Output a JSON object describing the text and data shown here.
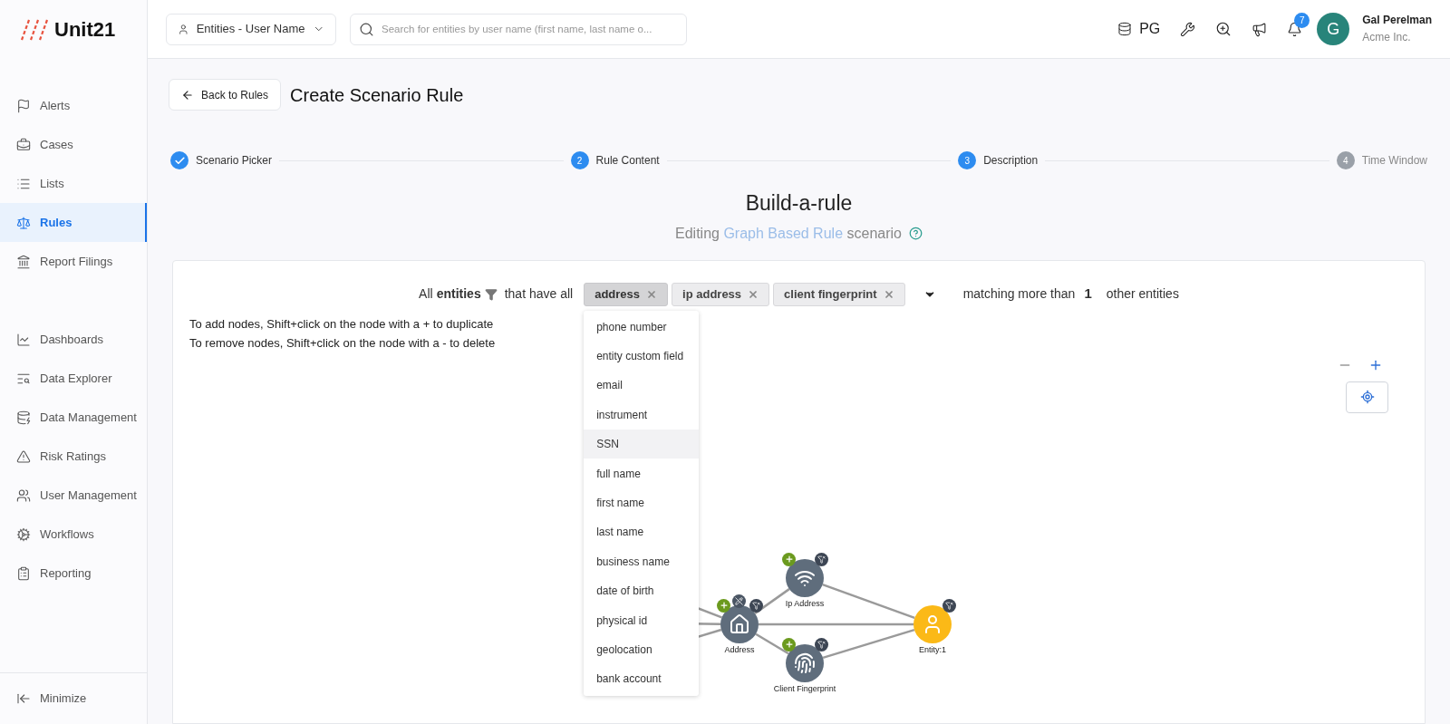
{
  "logo": {
    "text": "Unit21"
  },
  "topbar": {
    "entity_select": "Entities - User Name",
    "search": {
      "placeholder": "Search for entities by user name (first name, last name o..."
    },
    "env": "PG",
    "notifications": "7",
    "avatar": "G",
    "user_name": "Gal Perelman",
    "org": "Acme Inc."
  },
  "sidebar": {
    "groups": [
      [
        {
          "label": "Alerts",
          "selected": false
        },
        {
          "label": "Cases",
          "selected": false
        },
        {
          "label": "Lists",
          "selected": false
        },
        {
          "label": "Rules",
          "selected": true
        },
        {
          "label": "Report Filings",
          "selected": false
        }
      ],
      [
        {
          "label": "Dashboards",
          "selected": false
        },
        {
          "label": "Data Explorer",
          "selected": false
        },
        {
          "label": "Data Management",
          "selected": false
        },
        {
          "label": "Risk Ratings",
          "selected": false
        },
        {
          "label": "User Management",
          "selected": false
        },
        {
          "label": "Workflows",
          "selected": false
        },
        {
          "label": "Reporting",
          "selected": false
        }
      ]
    ],
    "footer": "Minimize"
  },
  "page": {
    "back_button": "Back to Rules",
    "title": "Create Scenario Rule"
  },
  "steps": [
    {
      "label": "Scenario Picker",
      "completed": true,
      "active": true
    },
    {
      "label": "Rule Content",
      "number": "2",
      "completed": false,
      "active": true
    },
    {
      "label": "Description",
      "number": "3",
      "completed": false,
      "active": true
    },
    {
      "label": "Time Window",
      "number": "4",
      "completed": false,
      "active": false
    }
  ],
  "builder": {
    "heading": "Build-a-rule",
    "subtitle_prefix": "Editing",
    "subtitle_link": "Graph Based Rule",
    "subtitle_suffix": "scenario"
  },
  "filter": {
    "prefix": "All",
    "entities": "entities",
    "middle": "that have all",
    "chips": [
      {
        "label": "address",
        "selected": true
      },
      {
        "label": "ip address",
        "selected": false
      },
      {
        "label": "client fingerprint",
        "selected": false
      }
    ],
    "matching": "matching more than",
    "count": "1",
    "suffix": "other entities"
  },
  "instructions": [
    "To add nodes, Shift+click on the node with a + to duplicate",
    "To remove nodes, Shift+click on the node with a - to delete"
  ],
  "dropdown": [
    {
      "label": "phone number",
      "selected": false
    },
    {
      "label": "entity custom field",
      "selected": false
    },
    {
      "label": "email",
      "selected": false
    },
    {
      "label": "instrument",
      "selected": false
    },
    {
      "label": "SSN",
      "selected": true
    },
    {
      "label": "full name",
      "selected": false
    },
    {
      "label": "first name",
      "selected": false
    },
    {
      "label": "last name",
      "selected": false
    },
    {
      "label": "business name",
      "selected": false
    },
    {
      "label": "date of birth",
      "selected": false
    },
    {
      "label": "physical id",
      "selected": false
    },
    {
      "label": "geolocation",
      "selected": false
    },
    {
      "label": "bank account",
      "selected": false
    }
  ],
  "graph": {
    "nodes": [
      {
        "label": "Address",
        "kind": "address"
      },
      {
        "label": "Ip Address",
        "kind": "ip"
      },
      {
        "label": "Client Fingerprint",
        "kind": "fingerprint"
      },
      {
        "label": "Entity:1",
        "kind": "entity"
      }
    ]
  }
}
